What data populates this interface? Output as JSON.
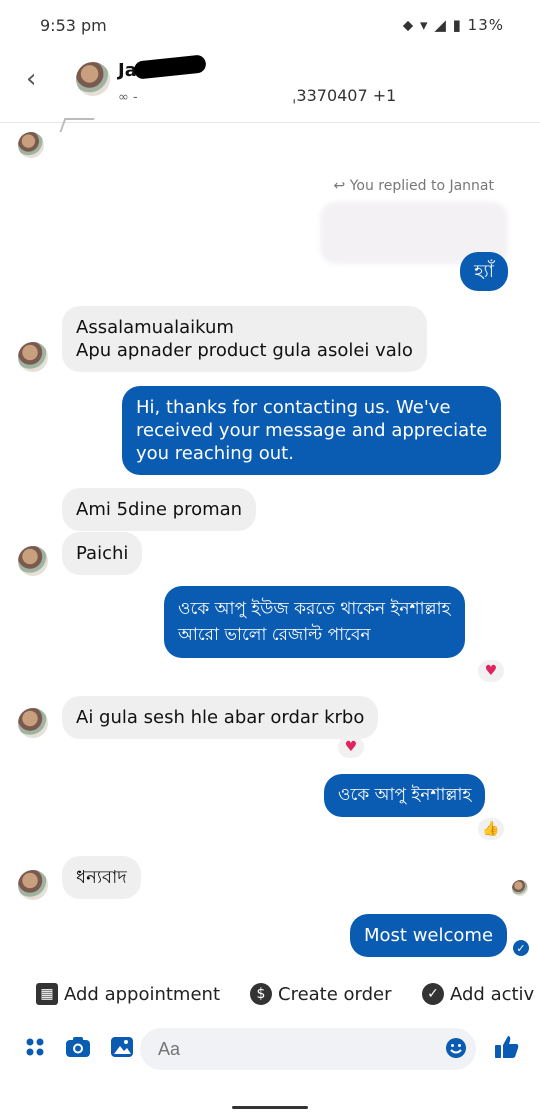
{
  "status_bar": {
    "time": "9:53 pm",
    "battery": "13%",
    "icons": "⬥ ▾ ◢ ▮"
  },
  "header": {
    "contact_name": "Ja",
    "contact_sub": "∞ -",
    "phone": "ˌ3370407 +1"
  },
  "reply_note": "↩ You replied to Jannat",
  "messages": [
    {
      "dir": "out",
      "text": "হ্যাঁ"
    },
    {
      "dir": "in",
      "text": "Assalamualaikum\nApu apnader product gula asolei valo"
    },
    {
      "dir": "out",
      "text": "Hi, thanks for contacting us. We've\nreceived your message and appreciate\nyou reaching out."
    },
    {
      "dir": "in",
      "text": "Ami 5dine proman"
    },
    {
      "dir": "in",
      "text": "Paichi"
    },
    {
      "dir": "out",
      "text": "ওকে আপু ইউজ করতে থাকেন ইনশাল্লাহ\nআরো ভালো রেজাল্ট পাবেন"
    },
    {
      "dir": "in",
      "text": "Ai gula sesh hle abar ordar krbo"
    },
    {
      "dir": "out",
      "text": "ওকে আপু ইনশাল্লাহ"
    },
    {
      "dir": "in",
      "text": "ধন্যবাদ"
    },
    {
      "dir": "out",
      "text": "Most welcome"
    }
  ],
  "reactions": {
    "heart": "♥",
    "thumbs": "👍"
  },
  "quick_actions": {
    "add_appointment": "Add appointment",
    "create_order": "Create order",
    "add_activity": "Add activ"
  },
  "composer": {
    "placeholder": "Aa"
  },
  "colors": {
    "accent": "#0a5bb2",
    "incoming": "#efefef"
  }
}
